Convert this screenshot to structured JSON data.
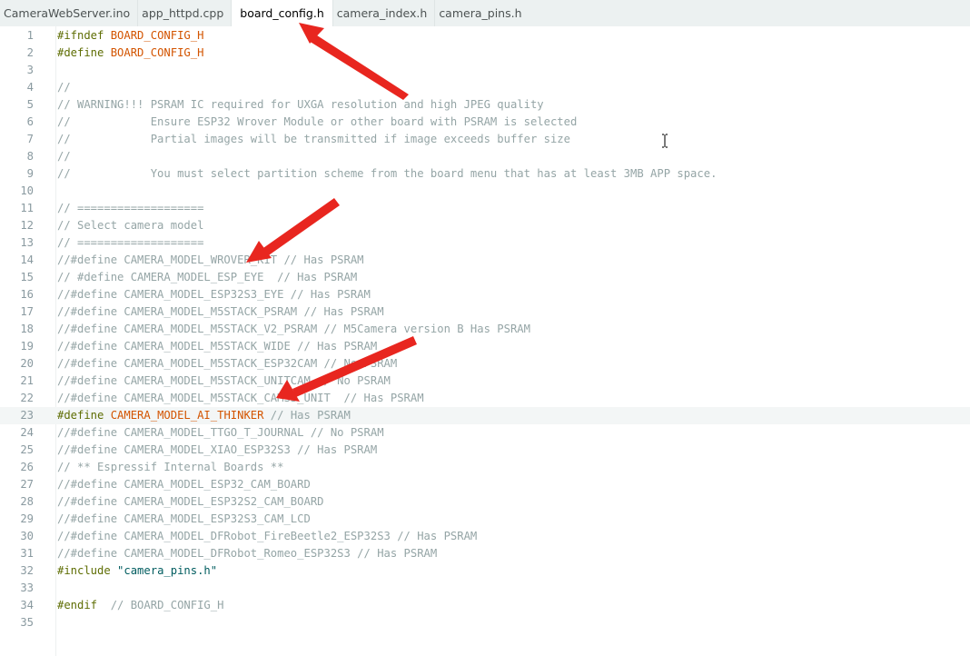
{
  "tabs": [
    {
      "label": "CameraWebServer.ino",
      "active": false
    },
    {
      "label": "app_httpd.cpp",
      "active": false
    },
    {
      "label": "board_config.h",
      "active": true
    },
    {
      "label": "camera_index.h",
      "active": false
    },
    {
      "label": "camera_pins.h",
      "active": false
    }
  ],
  "editor": {
    "highlighted_line": 23,
    "lines": [
      {
        "n": "1",
        "segs": [
          [
            "pp",
            "#ifndef "
          ],
          [
            "macro",
            "BOARD_CONFIG_H"
          ]
        ]
      },
      {
        "n": "2",
        "segs": [
          [
            "pp",
            "#define "
          ],
          [
            "macro",
            "BOARD_CONFIG_H"
          ]
        ]
      },
      {
        "n": "3",
        "segs": []
      },
      {
        "n": "4",
        "segs": [
          [
            "comment",
            "//"
          ]
        ]
      },
      {
        "n": "5",
        "segs": [
          [
            "comment",
            "// WARNING!!! PSRAM IC required for UXGA resolution and high JPEG quality"
          ]
        ]
      },
      {
        "n": "6",
        "segs": [
          [
            "comment",
            "//            Ensure ESP32 Wrover Module or other board with PSRAM is selected"
          ]
        ]
      },
      {
        "n": "7",
        "segs": [
          [
            "comment",
            "//            Partial images will be transmitted if image exceeds buffer size"
          ]
        ]
      },
      {
        "n": "8",
        "segs": [
          [
            "comment",
            "//"
          ]
        ]
      },
      {
        "n": "9",
        "segs": [
          [
            "comment",
            "//            You must select partition scheme from the board menu that has at least 3MB APP space."
          ]
        ]
      },
      {
        "n": "10",
        "segs": []
      },
      {
        "n": "11",
        "segs": [
          [
            "comment",
            "// ==================="
          ]
        ]
      },
      {
        "n": "12",
        "segs": [
          [
            "comment",
            "// Select camera model"
          ]
        ]
      },
      {
        "n": "13",
        "segs": [
          [
            "comment",
            "// ==================="
          ]
        ]
      },
      {
        "n": "14",
        "segs": [
          [
            "comment",
            "//#define CAMERA_MODEL_WROVER_KIT // Has PSRAM"
          ]
        ]
      },
      {
        "n": "15",
        "segs": [
          [
            "comment",
            "// #define CAMERA_MODEL_ESP_EYE  // Has PSRAM"
          ]
        ]
      },
      {
        "n": "16",
        "segs": [
          [
            "comment",
            "//#define CAMERA_MODEL_ESP32S3_EYE // Has PSRAM"
          ]
        ]
      },
      {
        "n": "17",
        "segs": [
          [
            "comment",
            "//#define CAMERA_MODEL_M5STACK_PSRAM // Has PSRAM"
          ]
        ]
      },
      {
        "n": "18",
        "segs": [
          [
            "comment",
            "//#define CAMERA_MODEL_M5STACK_V2_PSRAM // M5Camera version B Has PSRAM"
          ]
        ]
      },
      {
        "n": "19",
        "segs": [
          [
            "comment",
            "//#define CAMERA_MODEL_M5STACK_WIDE // Has PSRAM"
          ]
        ]
      },
      {
        "n": "20",
        "segs": [
          [
            "comment",
            "//#define CAMERA_MODEL_M5STACK_ESP32CAM // No PSRAM"
          ]
        ]
      },
      {
        "n": "21",
        "segs": [
          [
            "comment",
            "//#define CAMERA_MODEL_M5STACK_UNITCAM // No PSRAM"
          ]
        ]
      },
      {
        "n": "22",
        "segs": [
          [
            "comment",
            "//#define CAMERA_MODEL_M5STACK_CAMS3_UNIT  // Has PSRAM"
          ]
        ]
      },
      {
        "n": "23",
        "segs": [
          [
            "pp",
            "#define "
          ],
          [
            "macro",
            "CAMERA_MODEL_AI_THINKER"
          ],
          [
            "comment",
            " // Has PSRAM"
          ]
        ]
      },
      {
        "n": "24",
        "segs": [
          [
            "comment",
            "//#define CAMERA_MODEL_TTGO_T_JOURNAL // No PSRAM"
          ]
        ]
      },
      {
        "n": "25",
        "segs": [
          [
            "comment",
            "//#define CAMERA_MODEL_XIAO_ESP32S3 // Has PSRAM"
          ]
        ]
      },
      {
        "n": "26",
        "segs": [
          [
            "comment",
            "// ** Espressif Internal Boards **"
          ]
        ]
      },
      {
        "n": "27",
        "segs": [
          [
            "comment",
            "//#define CAMERA_MODEL_ESP32_CAM_BOARD"
          ]
        ]
      },
      {
        "n": "28",
        "segs": [
          [
            "comment",
            "//#define CAMERA_MODEL_ESP32S2_CAM_BOARD"
          ]
        ]
      },
      {
        "n": "29",
        "segs": [
          [
            "comment",
            "//#define CAMERA_MODEL_ESP32S3_CAM_LCD"
          ]
        ]
      },
      {
        "n": "30",
        "segs": [
          [
            "comment",
            "//#define CAMERA_MODEL_DFRobot_FireBeetle2_ESP32S3 // Has PSRAM"
          ]
        ]
      },
      {
        "n": "31",
        "segs": [
          [
            "comment",
            "//#define CAMERA_MODEL_DFRobot_Romeo_ESP32S3 // Has PSRAM"
          ]
        ]
      },
      {
        "n": "32",
        "segs": [
          [
            "pp",
            "#include "
          ],
          [
            "str",
            "\"camera_pins.h\""
          ]
        ]
      },
      {
        "n": "33",
        "segs": []
      },
      {
        "n": "34",
        "segs": [
          [
            "pp",
            "#endif"
          ],
          [
            "comment",
            "  // BOARD_CONFIG_H"
          ]
        ]
      },
      {
        "n": "35",
        "segs": []
      }
    ]
  },
  "annotation_color": "#e8261f",
  "icons": {
    "text_cursor": "ibeam-cursor-icon",
    "arrows": "red-arrow-icon"
  }
}
